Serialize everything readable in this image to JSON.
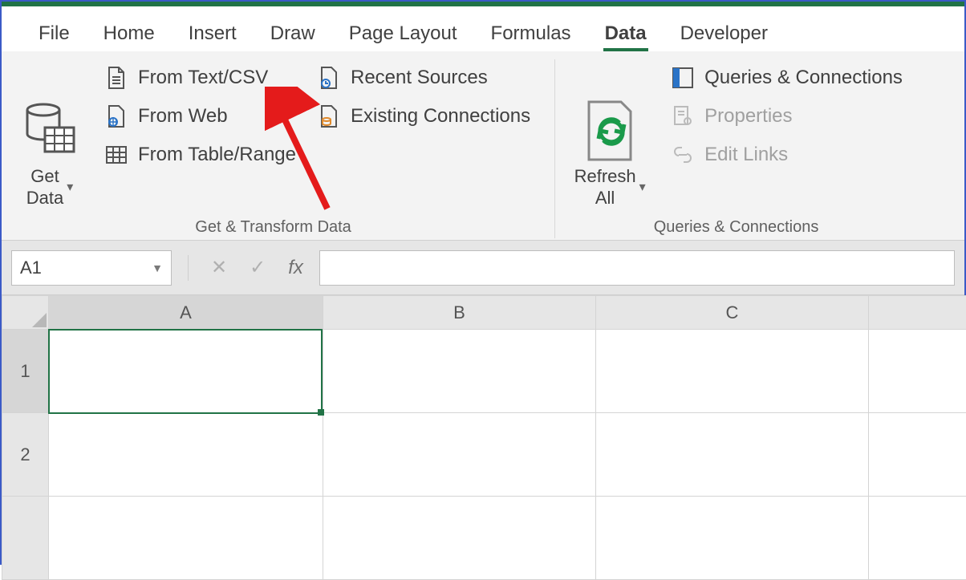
{
  "tabs": {
    "file": "File",
    "home": "Home",
    "insert": "Insert",
    "draw": "Draw",
    "pagelayout": "Page Layout",
    "formulas": "Formulas",
    "data": "Data",
    "developer": "Developer",
    "active": "data"
  },
  "ribbon": {
    "group_get_transform": {
      "label": "Get & Transform Data",
      "get_data_top": "Get",
      "get_data_bottom": "Data",
      "from_text_csv": "From Text/CSV",
      "from_web": "From Web",
      "from_table_range": "From Table/Range",
      "recent_sources": "Recent Sources",
      "existing_connections": "Existing Connections"
    },
    "group_queries": {
      "label": "Queries & Connections",
      "refresh_top": "Refresh",
      "refresh_bottom": "All",
      "queries_connections": "Queries & Connections",
      "properties": "Properties",
      "edit_links": "Edit Links"
    }
  },
  "formula_bar": {
    "namebox_value": "A1",
    "fx_label": "fx",
    "input_value": ""
  },
  "grid": {
    "columns": [
      "A",
      "B",
      "C"
    ],
    "rows": [
      "1",
      "2"
    ],
    "active_cell": "A1",
    "active_col_index": 0,
    "active_row_index": 0,
    "cells": [
      [
        "",
        "",
        ""
      ],
      [
        "",
        "",
        ""
      ]
    ]
  },
  "colors": {
    "accent": "#217346"
  }
}
